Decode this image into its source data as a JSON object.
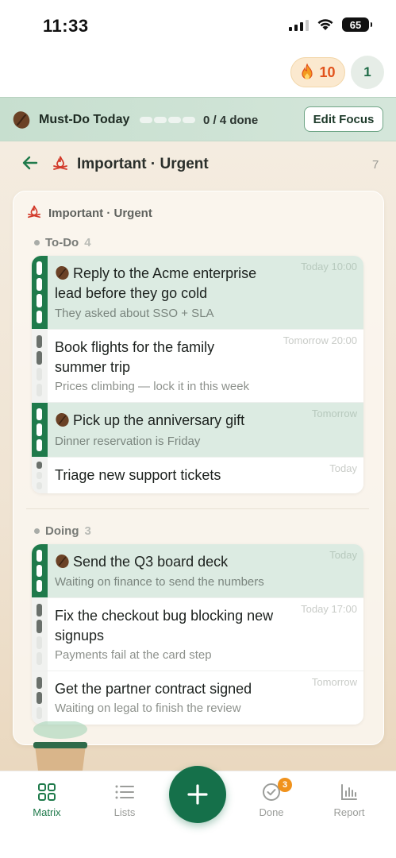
{
  "status_bar": {
    "time": "11:33",
    "battery": "65"
  },
  "top_bar": {
    "streak_count": "10",
    "level": "1"
  },
  "focus_banner": {
    "title": "Must-Do Today",
    "progress": "0 / 4 done",
    "edit_label": "Edit Focus",
    "done_count": 0,
    "total": 4
  },
  "nav": {
    "title": "Important · Urgent",
    "count": "7"
  },
  "card": {
    "title": "Important · Urgent",
    "sections": [
      {
        "label": "To-Do",
        "count": "4",
        "tasks": [
          {
            "title_line1": "Reply to the Acme enterprise",
            "title_line2": "lead before they go cold",
            "subtitle": "They asked about SSO + SLA",
            "time": "Today 10:00",
            "focus": true
          },
          {
            "title_line1": "Book flights for the family",
            "title_line2": "summer trip",
            "subtitle": "Prices climbing — lock it in this week",
            "time": "Tomorrow 20:00",
            "focus": false
          },
          {
            "title_line1": "Pick up the anniversary gift",
            "subtitle": "Dinner reservation is Friday",
            "time": "Tomorrow",
            "focus": true
          },
          {
            "title_line1": "Triage new support tickets",
            "time": "Today",
            "focus": false
          }
        ]
      },
      {
        "label": "Doing",
        "count": "3",
        "tasks": [
          {
            "title_line1": "Send the Q3 board deck",
            "subtitle": "Waiting on finance to send the numbers",
            "time": "Today",
            "focus": true
          },
          {
            "title_line1": "Fix the checkout bug blocking new",
            "title_line2": "signups",
            "subtitle": "Payments fail at the card step",
            "time": "Today 17:00",
            "focus": false
          },
          {
            "title_line1": "Get the partner contract signed",
            "subtitle": "Waiting on legal to finish the review",
            "time": "Tomorrow",
            "focus": false
          }
        ]
      }
    ]
  },
  "tab_bar": {
    "tabs": [
      {
        "label": "Matrix",
        "icon": "grid-icon",
        "active": true
      },
      {
        "label": "Lists",
        "icon": "list-icon",
        "active": false
      },
      {
        "label": "Done",
        "icon": "check-circle-icon",
        "active": false,
        "badge": "3"
      },
      {
        "label": "Report",
        "icon": "bar-chart-icon",
        "active": false
      }
    ],
    "fab_icon": "plus-icon"
  },
  "colors": {
    "accent": "#1f7a4b",
    "focus_row": "#dcebe2",
    "streak": "#e2531c",
    "badge": "#f0921c",
    "urgent_icon": "#d23a2a"
  }
}
